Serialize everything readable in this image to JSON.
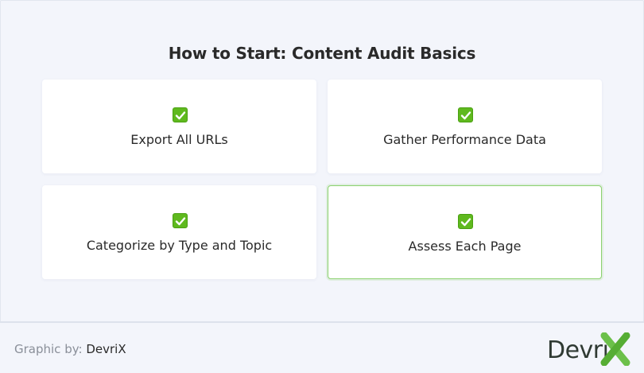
{
  "title": {
    "prefix": "How to Start: ",
    "emphasis": "Content Audit Basics"
  },
  "cards": [
    {
      "icon": "check-mark-icon",
      "label": "Export All URLs"
    },
    {
      "icon": "check-mark-icon",
      "label": "Gather Performance Data"
    },
    {
      "icon": "check-mark-icon",
      "label": "Categorize by Type and Topic"
    },
    {
      "icon": "check-mark-icon",
      "label": "Assess Each Page"
    }
  ],
  "footer": {
    "credit_prefix": "Graphic by: ",
    "credit_brand": "DevriX",
    "logo_text": "Devri",
    "logo_mark": "X"
  },
  "colors": {
    "background": "#f3f5fb",
    "check_green": "#5fb91e",
    "highlight_border": "#8bd16f",
    "logo_x_green": "#6cc04a"
  }
}
